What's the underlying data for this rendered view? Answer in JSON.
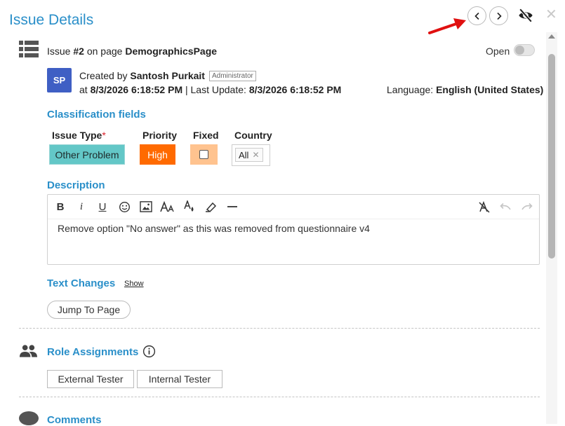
{
  "header": {
    "title": "Issue Details"
  },
  "issue": {
    "prefix": "Issue ",
    "number": "#2",
    "on_page": " on page ",
    "page_name": "DemographicsPage",
    "status": "Open"
  },
  "creator": {
    "initials": "SP",
    "created_by": "Created by ",
    "name": "Santosh Purkait",
    "role": "Administrator",
    "at": "at ",
    "created_date": "8/3/2026 6:18:52 PM",
    "last_update_label": " | Last Update: ",
    "last_update": "8/3/2026 6:18:52 PM",
    "language_label": "Language: ",
    "language": "English (United States)"
  },
  "classification": {
    "title": "Classification fields",
    "issue_type_label": "Issue Type",
    "required_mark": "*",
    "priority_label": "Priority",
    "fixed_label": "Fixed",
    "country_label": "Country",
    "issue_type_value": "Other Problem",
    "priority_value": "High",
    "country_value": "All",
    "country_remove": "✕"
  },
  "description": {
    "title": "Description",
    "content": "Remove option \"No answer\" as this was removed from questionnaire v4",
    "toolbar": {
      "bold": "B",
      "italic": "i",
      "underline": "U"
    }
  },
  "text_changes": {
    "title": "Text Changes",
    "show_link": "Show",
    "jump_button": "Jump To Page"
  },
  "roles": {
    "title": "Role Assignments",
    "items": [
      "External Tester",
      "Internal Tester"
    ]
  },
  "comments": {
    "title": "Comments"
  },
  "window": {
    "close_glyph": "✕"
  },
  "colors": {
    "accent": "#2a8fc9",
    "issue_type": "#63c7c7",
    "priority_high": "#ff6a00",
    "fixed": "#ffc38f",
    "avatar": "#3f5fc4"
  }
}
